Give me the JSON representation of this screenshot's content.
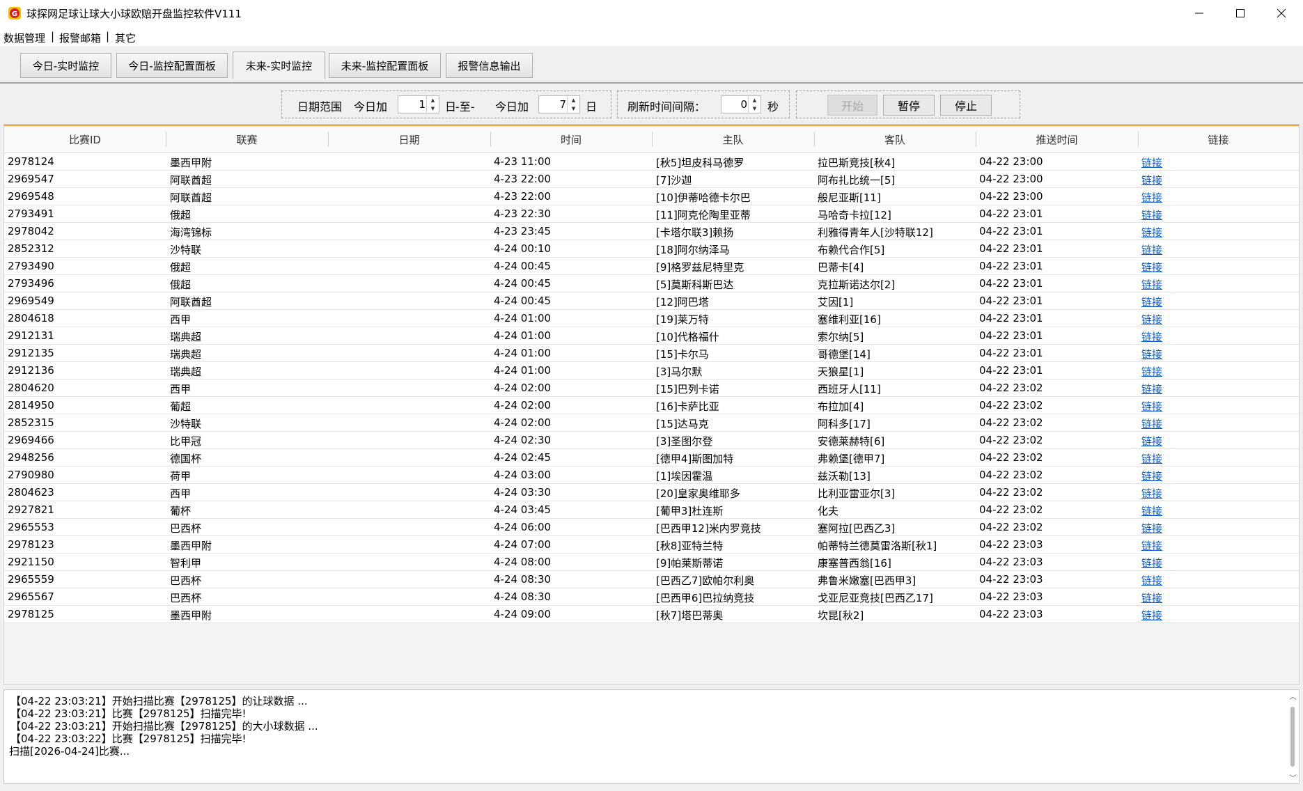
{
  "window": {
    "title": "球探网足球让球大小球欧赔开盘监控软件V111",
    "icon": "app-logo-icon",
    "controls": [
      "minimize-icon",
      "maximize-icon",
      "close-icon"
    ]
  },
  "menu": {
    "items": [
      {
        "label": "数据管理"
      },
      {
        "label": "报警邮箱"
      },
      {
        "label": "其它"
      }
    ],
    "separator": "|"
  },
  "tabs": [
    {
      "label": "今日-实时监控",
      "active": false
    },
    {
      "label": "今日-监控配置面板",
      "active": false
    },
    {
      "label": "未来-实时监控",
      "active": true
    },
    {
      "label": "未来-监控配置面板",
      "active": false
    },
    {
      "label": "报警信息输出",
      "active": false
    }
  ],
  "controls": {
    "date_range_label": "日期范围",
    "from_prefix": "今日加",
    "from_value": "1",
    "day_unit": "日",
    "to_separator": "-至-",
    "to_prefix": "今日加",
    "to_value": "7",
    "refresh_label": "刷新时间间隔：",
    "refresh_value": "0",
    "sec_unit": "秒",
    "start_label": "开始",
    "pause_label": "暂停",
    "stop_label": "停止"
  },
  "table": {
    "columns": [
      "比赛ID",
      "联赛",
      "日期",
      "时间",
      "主队",
      "客队",
      "推送时间",
      "链接"
    ],
    "rows": [
      [
        "2978124",
        "墨西甲附",
        "",
        "4-23 11:00",
        "[秋5]坦皮科马德罗",
        "拉巴斯竞技[秋4]",
        "04-22 23:00",
        "链接"
      ],
      [
        "2969547",
        "阿联酋超",
        "",
        "4-23 22:00",
        "[7]沙迦",
        "阿布扎比统一[5]",
        "04-22 23:00",
        "链接"
      ],
      [
        "2969548",
        "阿联酋超",
        "",
        "4-23 22:00",
        "[10]伊蒂哈德卡尔巴",
        "般尼亚斯[11]",
        "04-22 23:00",
        "链接"
      ],
      [
        "2793491",
        "俄超",
        "",
        "4-23 22:30",
        "[11]阿克伦陶里亚蒂",
        "马哈奇卡拉[12]",
        "04-22 23:01",
        "链接"
      ],
      [
        "2978042",
        "海湾锦标",
        "",
        "4-23 23:45",
        "[卡塔尔联3]赖扬",
        "利雅得青年人[沙特联12]",
        "04-22 23:01",
        "链接"
      ],
      [
        "2852312",
        "沙特联",
        "",
        "4-24 00:10",
        "[18]阿尔纳泽马",
        "布赖代合作[5]",
        "04-22 23:01",
        "链接"
      ],
      [
        "2793490",
        "俄超",
        "",
        "4-24 00:45",
        "[9]格罗兹尼特里克",
        "巴蒂卡[4]",
        "04-22 23:01",
        "链接"
      ],
      [
        "2793496",
        "俄超",
        "",
        "4-24 00:45",
        "[5]莫斯科斯巴达",
        "克拉斯诺达尔[2]",
        "04-22 23:01",
        "链接"
      ],
      [
        "2969549",
        "阿联酋超",
        "",
        "4-24 00:45",
        "[12]阿巴塔",
        "艾因[1]",
        "04-22 23:01",
        "链接"
      ],
      [
        "2804618",
        "西甲",
        "",
        "4-24 01:00",
        "[19]莱万特",
        "塞维利亚[16]",
        "04-22 23:01",
        "链接"
      ],
      [
        "2912131",
        "瑞典超",
        "",
        "4-24 01:00",
        "[10]代格福什",
        "索尔纳[5]",
        "04-22 23:01",
        "链接"
      ],
      [
        "2912135",
        "瑞典超",
        "",
        "4-24 01:00",
        "[15]卡尔马",
        "哥德堡[14]",
        "04-22 23:01",
        "链接"
      ],
      [
        "2912136",
        "瑞典超",
        "",
        "4-24 01:00",
        "[3]马尔默",
        "天狼星[1]",
        "04-22 23:01",
        "链接"
      ],
      [
        "2804620",
        "西甲",
        "",
        "4-24 02:00",
        "[15]巴列卡诺",
        "西班牙人[11]",
        "04-22 23:02",
        "链接"
      ],
      [
        "2814950",
        "葡超",
        "",
        "4-24 02:00",
        "[16]卡萨比亚",
        "布拉加[4]",
        "04-22 23:02",
        "链接"
      ],
      [
        "2852315",
        "沙特联",
        "",
        "4-24 02:00",
        "[15]达马克",
        "阿科多[17]",
        "04-22 23:02",
        "链接"
      ],
      [
        "2969466",
        "比甲冠",
        "",
        "4-24 02:30",
        "[3]圣图尔登",
        "安德莱赫特[6]",
        "04-22 23:02",
        "链接"
      ],
      [
        "2948256",
        "德国杯",
        "",
        "4-24 02:45",
        "[德甲4]斯图加特",
        "弗赖堡[德甲7]",
        "04-22 23:02",
        "链接"
      ],
      [
        "2790980",
        "荷甲",
        "",
        "4-24 03:00",
        "[1]埃因霍温",
        "兹沃勒[13]",
        "04-22 23:02",
        "链接"
      ],
      [
        "2804623",
        "西甲",
        "",
        "4-24 03:30",
        "[20]皇家奥维耶多",
        "比利亚雷亚尔[3]",
        "04-22 23:02",
        "链接"
      ],
      [
        "2927821",
        "葡杯",
        "",
        "4-24 03:45",
        "[葡甲3]杜连斯",
        "化夫",
        "04-22 23:02",
        "链接"
      ],
      [
        "2965553",
        "巴西杯",
        "",
        "4-24 06:00",
        "[巴西甲12]米内罗竞技",
        "塞阿拉[巴西乙3]",
        "04-22 23:02",
        "链接"
      ],
      [
        "2978123",
        "墨西甲附",
        "",
        "4-24 07:00",
        "[秋8]亚特兰特",
        "帕蒂特兰德莫雷洛斯[秋1]",
        "04-22 23:03",
        "链接"
      ],
      [
        "2921150",
        "智利甲",
        "",
        "4-24 08:00",
        "[9]帕莱斯蒂诺",
        "康塞普西翁[16]",
        "04-22 23:03",
        "链接"
      ],
      [
        "2965559",
        "巴西杯",
        "",
        "4-24 08:30",
        "[巴西乙7]欧帕尔利奥",
        "弗鲁米嫩塞[巴西甲3]",
        "04-22 23:03",
        "链接"
      ],
      [
        "2965567",
        "巴西杯",
        "",
        "4-24 08:30",
        "[巴西甲6]巴拉纳竞技",
        "戈亚尼亚竞技[巴西乙17]",
        "04-22 23:03",
        "链接"
      ],
      [
        "2978125",
        "墨西甲附",
        "",
        "4-24 09:00",
        "[秋7]塔巴蒂奥",
        "坎昆[秋2]",
        "04-22 23:03",
        "链接"
      ]
    ]
  },
  "log": {
    "lines": [
      "【04-22 23:03:21】开始扫描比赛【2978125】的让球数据 ...",
      "【04-22 23:03:21】比赛【2978125】扫描完毕!",
      "【04-22 23:03:21】开始扫描比赛【2978125】的大小球数据 ...",
      "【04-22 23:03:22】比赛【2978125】扫描完毕!",
      "扫描[2026-04-24]比赛..."
    ]
  },
  "colors": {
    "accent_line": "#f0a030",
    "link": "#0b5bd3",
    "app_icon_red": "#d42020",
    "app_icon_yellow": "#f2c200"
  }
}
